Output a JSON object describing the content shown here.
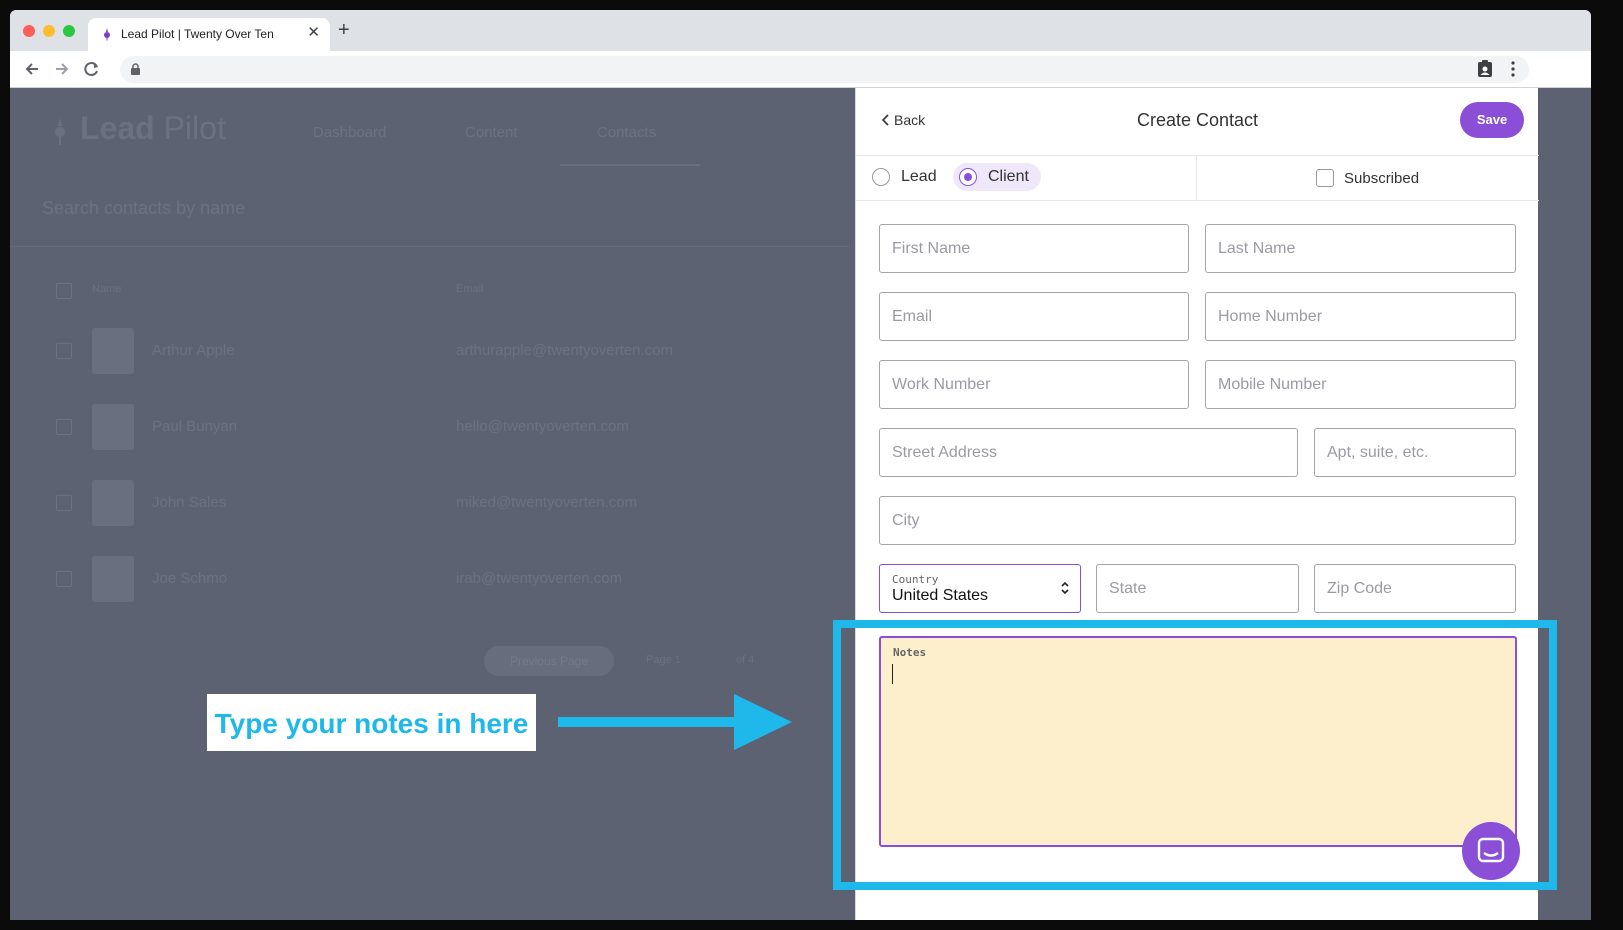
{
  "browser": {
    "tab_title": "Lead Pilot | Twenty Over Ten",
    "tab_close": "✕",
    "new_tab": "+"
  },
  "background_app": {
    "logo_bold": "Lead",
    "logo_light": "Pilot",
    "nav": [
      "Dashboard",
      "Content",
      "Contacts"
    ],
    "search_placeholder": "Search contacts by name",
    "columns": [
      "Name",
      "Email"
    ],
    "rows": [
      {
        "name": "Arthur Apple",
        "email": "arthurapple@twentyoverten.com"
      },
      {
        "name": "Paul Bunyan",
        "email": "hello@twentyoverten.com"
      },
      {
        "name": "John Sales",
        "email": "miked@twentyoverten.com"
      },
      {
        "name": "Joe Schmo",
        "email": "irab@twentyoverten.com"
      }
    ],
    "pager_button": "Previous Page",
    "pager_info": [
      "Page 1",
      "of 4"
    ]
  },
  "panel": {
    "back_label": "Back",
    "title": "Create Contact",
    "save_label": "Save",
    "type_options": [
      "Lead",
      "Client"
    ],
    "selected_type": "Client",
    "subscribed_label": "Subscribed",
    "subscribed_checked": false,
    "fields": {
      "first_name": "First Name",
      "last_name": "Last Name",
      "email": "Email",
      "home_number": "Home Number",
      "work_number": "Work Number",
      "mobile_number": "Mobile Number",
      "street_address": "Street Address",
      "apt": "Apt, suite, etc.",
      "city": "City",
      "state": "State",
      "zip": "Zip Code"
    },
    "country": {
      "label": "Country",
      "value": "United States"
    },
    "notes_label": "Notes"
  },
  "annotation": {
    "callout": "Type your notes in here",
    "color": "#1fb8ea"
  },
  "colors": {
    "accent": "#8a4fd6",
    "notes_bg": "#fdefcc",
    "overlay": "#5d6273"
  }
}
